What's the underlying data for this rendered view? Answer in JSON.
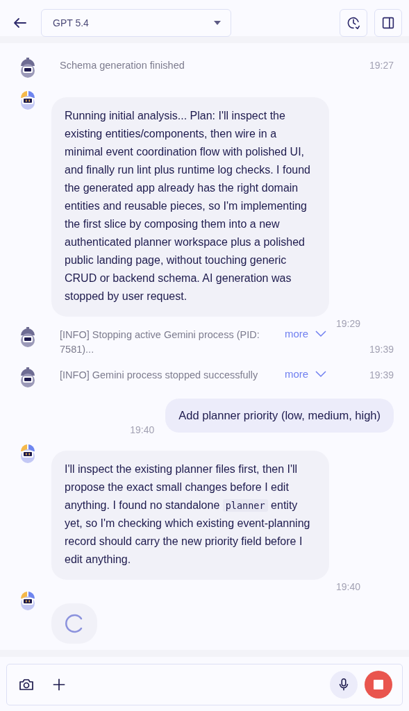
{
  "header": {
    "model": "GPT 5.4"
  },
  "messages": [
    {
      "kind": "system",
      "text": "Schema generation finished",
      "time": "19:27"
    },
    {
      "kind": "ai",
      "parts": [
        {
          "kind": "text",
          "text": "Running initial analysis... Plan: I'll inspect the existing entities/components, then wire in a minimal event coordination flow with polished UI, and finally run lint plus runtime log checks. I found the generated app already has the right domain entities and reusable pieces, so I'm implementing the first slice by composing them into a new authenticated planner workspace plus a polished public landing page, without touching generic CRUD or backend schema. AI generation was stopped by user request."
        }
      ],
      "time": "19:29"
    },
    {
      "kind": "system",
      "text": "[INFO] Stopping active Gemini process (PID: 7581)...",
      "more": "more",
      "time": "19:39"
    },
    {
      "kind": "system",
      "text": "[INFO] Gemini process stopped successfully",
      "more": "more",
      "time": "19:39"
    },
    {
      "kind": "user",
      "text": "Add planner priority (low, medium, high)",
      "time": "19:40"
    },
    {
      "kind": "ai",
      "parts": [
        {
          "kind": "text",
          "text": "I'll inspect the existing planner files first, then I'll propose the exact small changes before I edit anything. I found no standalone "
        },
        {
          "kind": "code",
          "text": "planner"
        },
        {
          "kind": "text",
          "text": " entity yet, so I'm checking which existing event-planning record should carry the new priority field before I edit anything."
        }
      ],
      "time": "19:40"
    },
    {
      "kind": "loading"
    }
  ]
}
